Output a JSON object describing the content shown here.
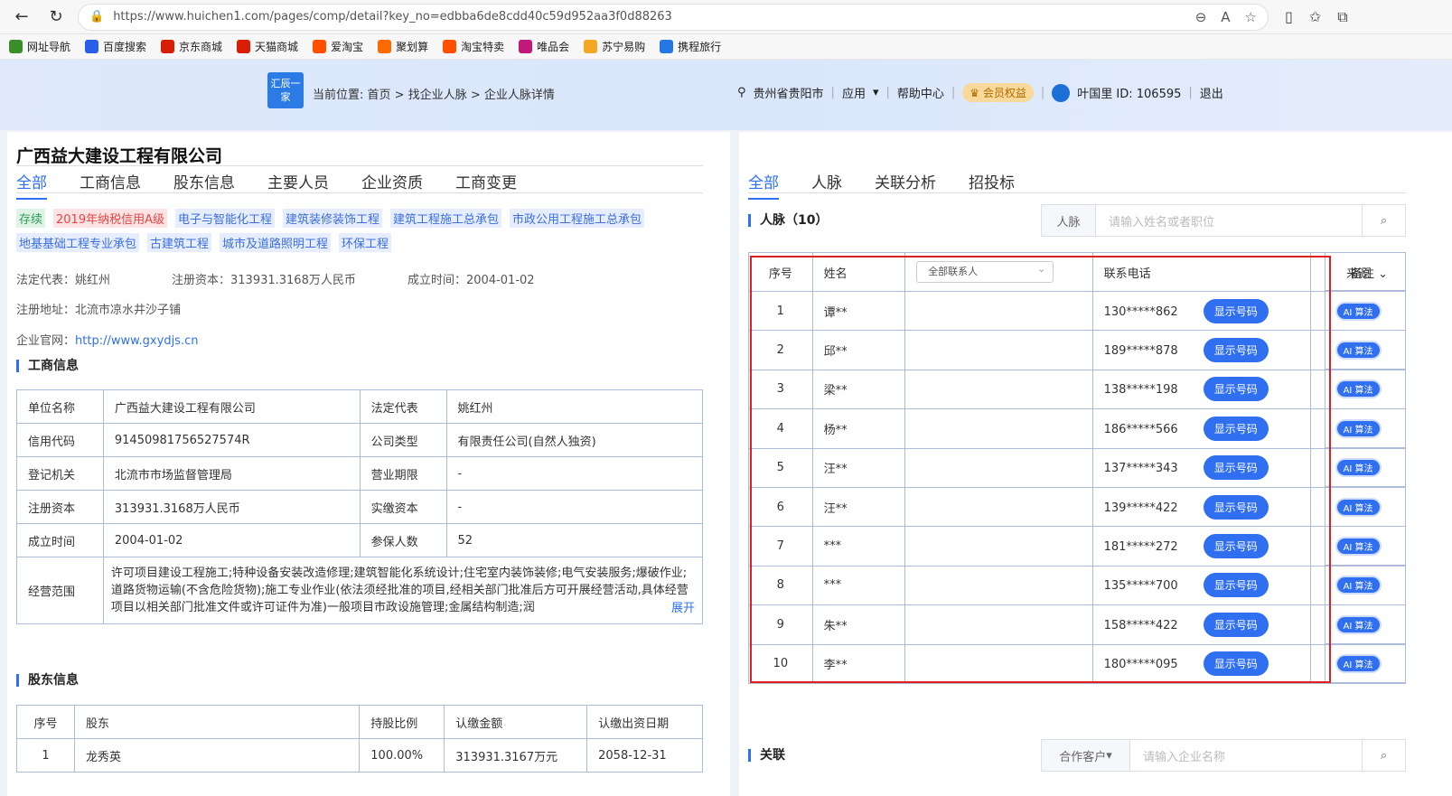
{
  "browser": {
    "url": "https://www.huichen1.com/pages/comp/detail?key_no=edbba6de8cdd40c59d952aa3f0d88263",
    "bookmarks": [
      "网址导航",
      "百度搜索",
      "京东商城",
      "天猫商城",
      "爱淘宝",
      "聚划算",
      "淘宝特卖",
      "唯品会",
      "苏宁易购",
      "携程旅行"
    ]
  },
  "header": {
    "logo": "汇辰一家",
    "location_label": "当前位置:",
    "breadcrumb": "首页 > 找企业人脉 > 企业人脉详情",
    "city": "贵州省贵阳市",
    "apps": "应用",
    "help": "帮助中心",
    "vip": "会员权益",
    "user": "叶国里 ID: 106595",
    "logout": "退出"
  },
  "company": {
    "name": "广西益大建设工程有限公司",
    "tabs": [
      "全部",
      "工商信息",
      "股东信息",
      "主要人员",
      "企业资质",
      "工商变更"
    ],
    "tags": [
      {
        "text": "存续",
        "style": "green"
      },
      {
        "text": "2019年纳税信用A级",
        "style": "red"
      },
      {
        "text": "电子与智能化工程",
        "style": "blue"
      },
      {
        "text": "建筑装修装饰工程",
        "style": "blue"
      },
      {
        "text": "建筑工程施工总承包",
        "style": "blue"
      },
      {
        "text": "市政公用工程施工总承包",
        "style": "blue"
      },
      {
        "text": "地基基础工程专业承包",
        "style": "blue"
      },
      {
        "text": "古建筑工程",
        "style": "blue"
      },
      {
        "text": "城市及道路照明工程",
        "style": "blue"
      },
      {
        "text": "环保工程",
        "style": "blue"
      }
    ],
    "legal_rep": "法定代表：姚红州",
    "reg_capital": "注册资本：313931.3168万人民币",
    "founded": "成立时间：2004-01-02",
    "address": "注册地址：北流市凉水井沙子铺",
    "website_label": "企业官网：",
    "website": "http://www.gxydjs.cn",
    "business_title": "工商信息",
    "business": [
      [
        "单位名称",
        "广西益大建设工程有限公司",
        "法定代表",
        "姚红州"
      ],
      [
        "信用代码",
        "91450981756527574R",
        "公司类型",
        "有限责任公司(自然人独资)"
      ],
      [
        "登记机关",
        "北流市市场监督管理局",
        "营业期限",
        "-"
      ],
      [
        "注册资本",
        "313931.3168万人民币",
        "实缴资本",
        "-"
      ],
      [
        "成立时间",
        "2004-01-02",
        "参保人数",
        "52"
      ]
    ],
    "scope_label": "经营范围",
    "scope": "许可项目建设工程施工;特种设备安装改造修理;建筑智能化系统设计;住宅室内装饰装修;电气安装服务;爆破作业;道路货物运输(不含危险货物);施工专业作业(依法须经批准的项目,经相关部门批准后方可开展经营活动,具体经营项目以相关部门批准文件或许可证件为准)一般项目市政设施管理;金属结构制造;润",
    "expand": "展开",
    "shareholder_title": "股东信息",
    "shareholder_headers": [
      "序号",
      "股东",
      "持股比例",
      "认缴金额",
      "认缴出资日期"
    ],
    "shareholders": [
      [
        "1",
        "龙秀英",
        "100.00%",
        "313931.3167万元",
        "2058-12-31"
      ]
    ]
  },
  "contacts": {
    "tabs": [
      "全部",
      "人脉",
      "关联分析",
      "招投标"
    ],
    "title": "人脉（10）",
    "search_prefix": "人脉",
    "search_placeholder": "请输入姓名或者职位",
    "headers": {
      "no": "序号",
      "name": "姓名",
      "filter": "全部联系人",
      "phone": "联系电话",
      "source": "来源",
      "remark": "备注"
    },
    "show_btn": "显示号码",
    "source_badge": "算法",
    "rows": [
      [
        "1",
        "谭**",
        "130*****862"
      ],
      [
        "2",
        "邱**",
        "189*****878"
      ],
      [
        "3",
        "梁**",
        "138*****198"
      ],
      [
        "4",
        "杨**",
        "186*****566"
      ],
      [
        "5",
        "汪**",
        "137*****343"
      ],
      [
        "6",
        "汪**",
        "139*****422"
      ],
      [
        "7",
        "***",
        "181*****272"
      ],
      [
        "8",
        "***",
        "135*****700"
      ],
      [
        "9",
        "朱**",
        "158*****422"
      ],
      [
        "10",
        "李**",
        "180*****095"
      ]
    ],
    "related_title": "关联",
    "related_prefix": "合作客户",
    "related_placeholder": "请输入企业名称"
  }
}
